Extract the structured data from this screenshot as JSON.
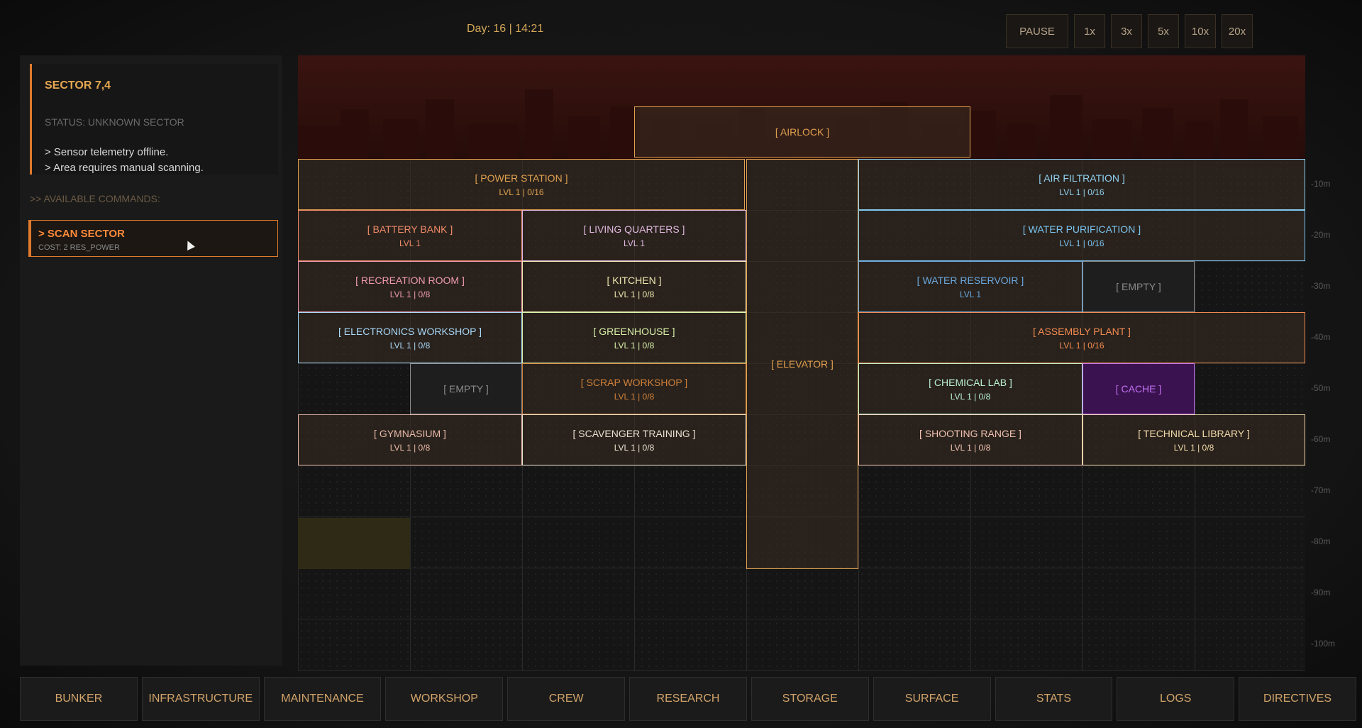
{
  "header": {
    "clock": "Day: 16 | 14:21"
  },
  "speed_controls": {
    "pause": "PAUSE",
    "x1": "1x",
    "x3": "3x",
    "x5": "5x",
    "x10": "10x",
    "x20": "20x"
  },
  "sector": {
    "title": "SECTOR 7,4",
    "status": "STATUS: UNKNOWN SECTOR",
    "lines": [
      "> Sensor telemetry offline.",
      "> Area requires manual scanning."
    ]
  },
  "commands": {
    "label": ">> AVAILABLE COMMANDS:",
    "scan": {
      "label": "> SCAN SECTOR",
      "cost": "COST: 2 RES_POWER"
    }
  },
  "rooms": {
    "airlock": {
      "name": "[ AIRLOCK ]",
      "lvl": "",
      "color": "#e0a050"
    },
    "power_station": {
      "name": "[ POWER STATION ]",
      "lvl": "LVL 1 | 0/16",
      "color": "#e0a050"
    },
    "air_filtration": {
      "name": "[ AIR FILTRATION ]",
      "lvl": "LVL 1 | 0/16",
      "color": "#8fd0f0"
    },
    "battery_bank": {
      "name": "[ BATTERY BANK ]",
      "lvl": "LVL 1",
      "color": "#f08a6a"
    },
    "living_quarters": {
      "name": "[ LIVING QUARTERS ]",
      "lvl": "LVL 1",
      "color": "#e0b8e0"
    },
    "water_purification": {
      "name": "[ WATER PURIFICATION ]",
      "lvl": "LVL 1 | 0/16",
      "color": "#7ac4f0"
    },
    "recreation_room": {
      "name": "[ RECREATION ROOM ]",
      "lvl": "LVL 1 | 0/8",
      "color": "#f09ab0"
    },
    "kitchen": {
      "name": "[ KITCHEN ]",
      "lvl": "LVL 1 | 0/8",
      "color": "#f0e8b0"
    },
    "water_reservoir": {
      "name": "[ WATER RESERVOIR ]",
      "lvl": "LVL 1",
      "color": "#6aa8e0"
    },
    "empty_right": {
      "name": "[ EMPTY ]",
      "lvl": "",
      "color": "#8a8a8a"
    },
    "electronics_workshop": {
      "name": "[ ELECTRONICS WORKSHOP ]",
      "lvl": "LVL 1 | 0/8",
      "color": "#a8d8f8"
    },
    "greenhouse": {
      "name": "[ GREENHOUSE ]",
      "lvl": "LVL 1 | 0/8",
      "color": "#d8f0a8"
    },
    "elevator": {
      "name": "[ ELEVATOR ]",
      "lvl": "",
      "color": "#e0a050"
    },
    "assembly_plant": {
      "name": "[ ASSEMBLY PLANT ]",
      "lvl": "LVL 1 | 0/16",
      "color": "#f08a50"
    },
    "empty_left": {
      "name": "[ EMPTY ]",
      "lvl": "",
      "color": "#8a8a8a"
    },
    "scrap_workshop": {
      "name": "[ SCRAP WORKSHOP ]",
      "lvl": "LVL 1 | 0/8",
      "color": "#d0803a"
    },
    "chemical_lab": {
      "name": "[ CHEMICAL LAB ]",
      "lvl": "LVL 1 | 0/8",
      "color": "#b8f0d0"
    },
    "cache": {
      "name": "[ CACHE ]",
      "lvl": "",
      "color": "#c070f0"
    },
    "gymnasium": {
      "name": "[ GYMNASIUM ]",
      "lvl": "LVL 1 | 0/8",
      "color": "#e8b8a8"
    },
    "scavenger_training": {
      "name": "[ SCAVENGER TRAINING ]",
      "lvl": "LVL 1 | 0/8",
      "color": "#e8e0d0"
    },
    "shooting_range": {
      "name": "[ SHOOTING RANGE ]",
      "lvl": "LVL 1 | 0/8",
      "color": "#f0c0b0"
    },
    "technical_library": {
      "name": "[ TECHNICAL LIBRARY ]",
      "lvl": "LVL 1 | 0/8",
      "color": "#f0d8a8"
    }
  },
  "depth_labels": [
    "-10m",
    "-20m",
    "-30m",
    "-40m",
    "-50m",
    "-60m",
    "-70m",
    "-80m",
    "-90m",
    "-100m"
  ],
  "tabs": [
    "BUNKER",
    "INFRASTRUCTURE",
    "MAINTENANCE",
    "WORKSHOP",
    "CREW",
    "RESEARCH",
    "STORAGE",
    "SURFACE",
    "STATS",
    "LOGS",
    "DIRECTIVES"
  ]
}
